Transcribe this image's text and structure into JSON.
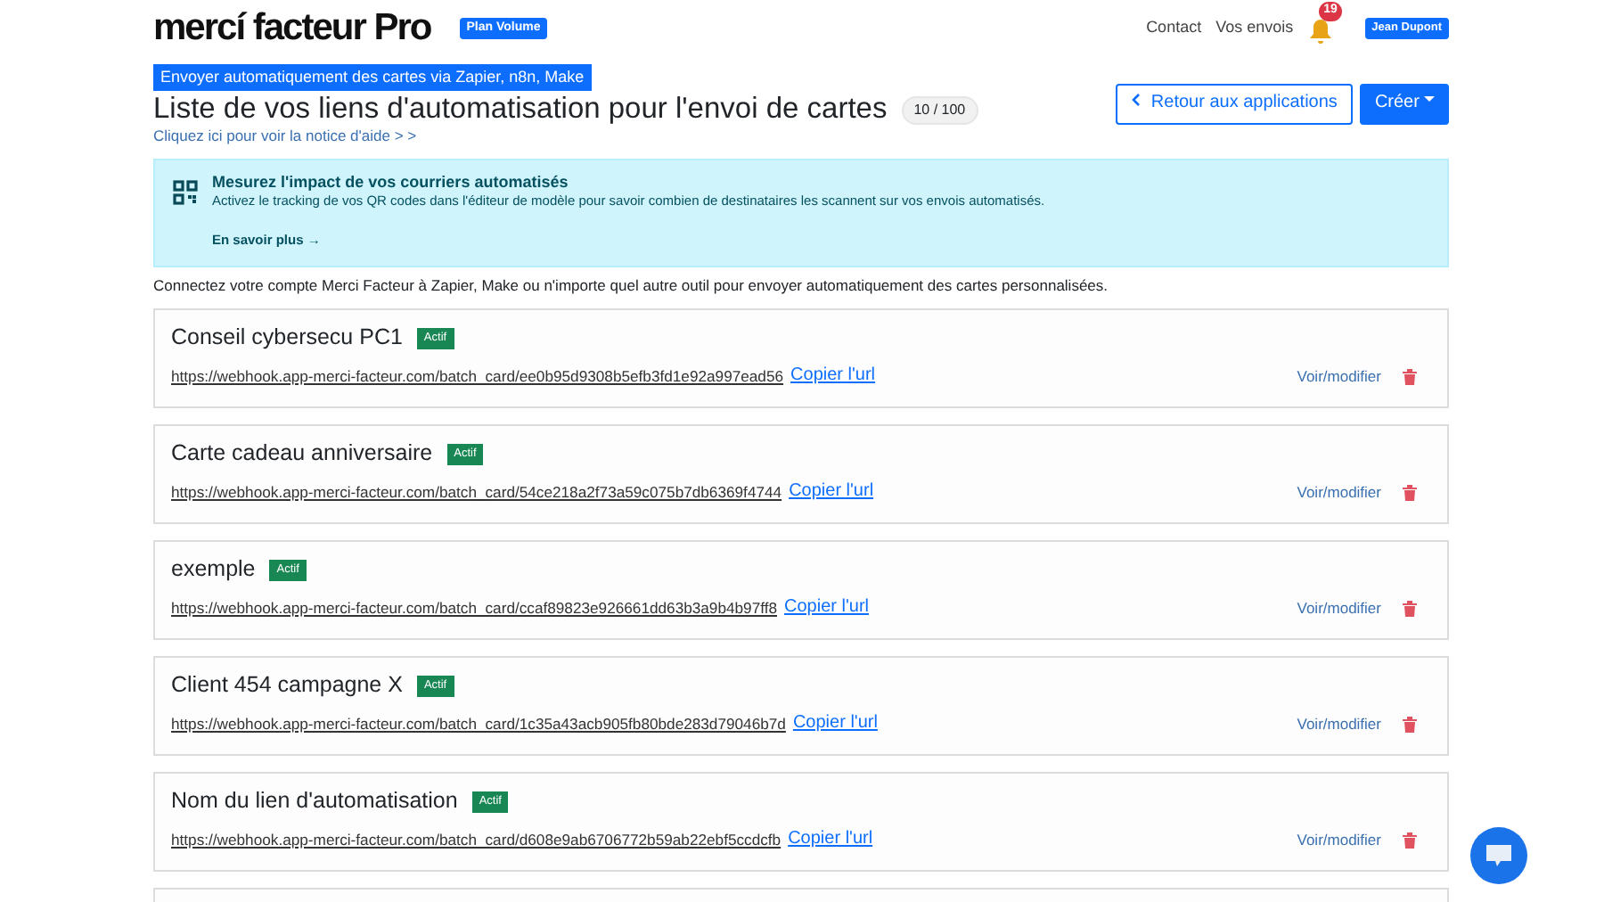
{
  "header": {
    "logo": "mercí facteur Pro",
    "plan": "Plan Volume",
    "nav": [
      "Contact",
      "Vos envois"
    ],
    "notifications": "19",
    "user": "Jean Dupont"
  },
  "page": {
    "breadcrumb": "Envoyer automatiquement des cartes via Zapier, n8n, Make",
    "title": "Liste de vos liens d'automatisation pour l'envoi de cartes",
    "counter": "10 / 100",
    "help_link": "Cliquez ici pour voir la notice d'aide > >",
    "back_button": "Retour aux applications",
    "create_button": "Créer"
  },
  "alert": {
    "title": "Mesurez l'impact de vos courriers automatisés",
    "text": "Activez le tracking de vos QR codes dans l'éditeur de modèle pour savoir combien de destinataires les scannent sur vos envois automatisés.",
    "link": "En savoir plus →"
  },
  "intro": "Connectez votre compte Merci Facteur à Zapier, Make ou n'importe quel autre outil pour envoyer automatiquement des cartes personnalisées.",
  "links": [
    {
      "name": "Conseil cybersecu PC1",
      "status": "Actif",
      "active": true,
      "url": "https://webhook.app-merci-facteur.com/batch_card/ee0b95d9308b5efb3fd1e92a997ead56",
      "copy": "Copier l'url",
      "edit": "Voir/modifier"
    },
    {
      "name": "Carte cadeau anniversaire",
      "status": "Actif",
      "active": true,
      "url": "https://webhook.app-merci-facteur.com/batch_card/54ce218a2f73a59c075b7db6369f4744",
      "copy": "Copier l'url",
      "edit": "Voir/modifier"
    },
    {
      "name": "exemple",
      "status": "Actif",
      "active": true,
      "url": "https://webhook.app-merci-facteur.com/batch_card/ccaf89823e926661dd63b3a9b4b97ff8",
      "copy": "Copier l'url",
      "edit": "Voir/modifier"
    },
    {
      "name": "Client 454 campagne X",
      "status": "Actif",
      "active": true,
      "url": "https://webhook.app-merci-facteur.com/batch_card/1c35a43acb905fb80bde283d79046b7d",
      "copy": "Copier l'url",
      "edit": "Voir/modifier"
    },
    {
      "name": "Nom du lien d'automatisation",
      "status": "Actif",
      "active": true,
      "url": "https://webhook.app-merci-facteur.com/batch_card/d608e9ab6706772b59ab22ebf5ccdcfb",
      "copy": "Copier l'url",
      "edit": "Voir/modifier"
    }
  ]
}
